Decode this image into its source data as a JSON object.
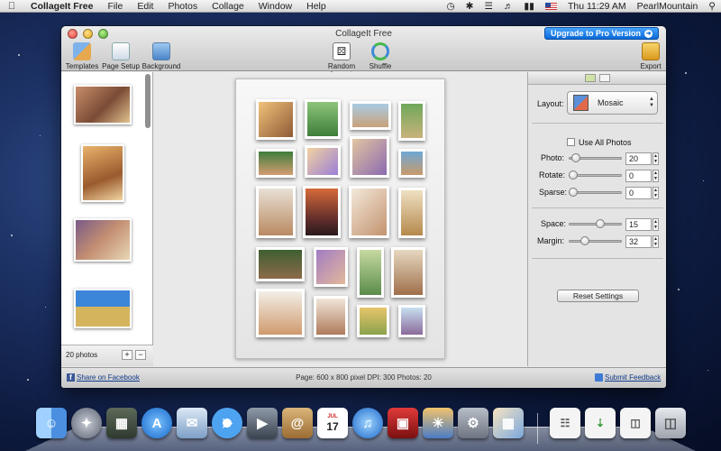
{
  "menubar": {
    "app_name": "CollageIt Free",
    "items": [
      "File",
      "Edit",
      "Photos",
      "Collage",
      "Window",
      "Help"
    ],
    "clock": "Thu 11:29 AM",
    "user": "PearlMountain"
  },
  "window": {
    "title": "CollageIt Free",
    "upgrade_label": "Upgrade to Pro Version"
  },
  "toolbar": {
    "templates": "Templates",
    "page_setup": "Page Setup",
    "background": "Background",
    "random_layout": "Random Layout",
    "shuffle": "Shuffle",
    "export": "Export"
  },
  "photos_panel": {
    "count_label": "20 photos",
    "add_label": "+",
    "remove_label": "−"
  },
  "settings": {
    "layout_label": "Layout:",
    "layout_value": "Mosaic",
    "use_all_photos": "Use All Photos",
    "photo_label": "Photo:",
    "photo_value": "20",
    "rotate_label": "Rotate:",
    "rotate_value": "0",
    "sparse_label": "Sparse:",
    "sparse_value": "0",
    "space_label": "Space:",
    "space_value": "15",
    "margin_label": "Margin:",
    "margin_value": "32",
    "reset_label": "Reset Settings"
  },
  "footer": {
    "share_label": "Share on Facebook",
    "status": "Page: 600 x 800 pixel DPI: 300 Photos: 20",
    "feedback_label": "Submit Feedback"
  },
  "dock": {
    "calendar_month": "JUL",
    "calendar_day": "17"
  }
}
